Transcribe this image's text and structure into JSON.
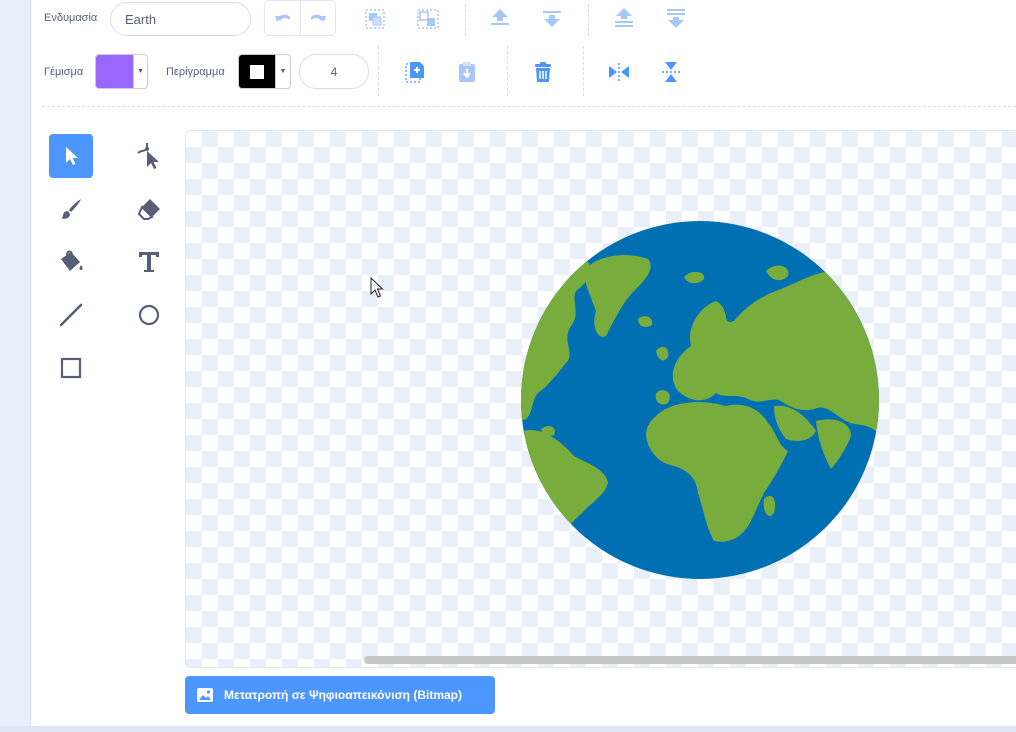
{
  "costume": {
    "label": "Ενδυμασία",
    "name_value": "Earth"
  },
  "fill": {
    "label": "Γέμισμα",
    "color": "#9966ff"
  },
  "outline": {
    "label": "Περίγραμμα",
    "color": "#000000",
    "width_value": "4"
  },
  "toolbar": {
    "icons": [
      "undo-icon",
      "redo-icon",
      "group-icon",
      "ungroup-icon",
      "forward-icon",
      "backward-icon",
      "front-icon",
      "back-icon",
      "copy-icon",
      "paste-icon",
      "delete-icon",
      "flip-horizontal-icon",
      "flip-vertical-icon"
    ]
  },
  "tools": [
    "select",
    "reshape",
    "brush",
    "eraser",
    "fill",
    "text",
    "line",
    "circle",
    "rectangle"
  ],
  "active_tool": "select",
  "convert_button": {
    "label": "Μετατροπή σε Ψηφιοαπεικόνιση (Bitmap)"
  },
  "colors": {
    "accent": "#4c97ff",
    "ocean": "#0070b3",
    "land": "#78ad3e",
    "text": "#575e75"
  }
}
